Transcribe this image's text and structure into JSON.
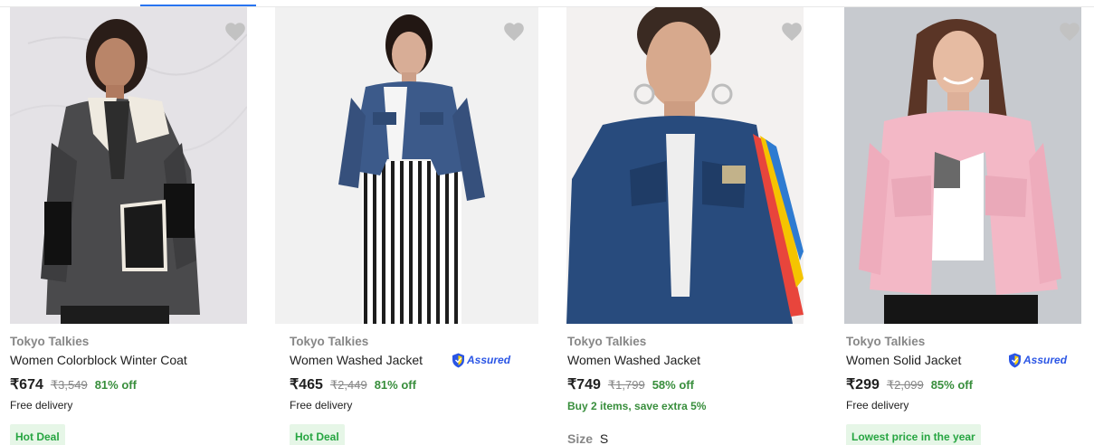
{
  "products": [
    {
      "brand": "Tokyo Talkies",
      "title": "Women Colorblock Winter Coat",
      "price": "₹674",
      "mrp": "₹3,549",
      "discount": "81% off",
      "delivery": "Free delivery",
      "badge": "Hot Deal",
      "image_alt": "Woman in grey colorblock winter coat with white lapels"
    },
    {
      "brand": "Tokyo Talkies",
      "title": "Women Washed Jacket",
      "price": "₹465",
      "mrp": "₹2,449",
      "discount": "81% off",
      "delivery": "Free delivery",
      "badge": "Hot Deal",
      "assured": "Assured",
      "image_alt": "Woman in cropped blue denim jacket over striped dress"
    },
    {
      "brand": "Tokyo Talkies",
      "title": "Women Washed Jacket",
      "price": "₹749",
      "mrp": "₹1,799",
      "discount": "58% off",
      "offer": "Buy 2 items, save extra 5%",
      "size_label": "Size",
      "size_value": "S",
      "image_alt": "Woman in dark blue denim jacket with rainbow sleeve stripe"
    },
    {
      "brand": "Tokyo Talkies",
      "title": "Women Solid Jacket",
      "price": "₹299",
      "mrp": "₹2,099",
      "discount": "85% off",
      "delivery": "Free delivery",
      "badge": "Lowest price in the year",
      "assured": "Assured",
      "image_alt": "Smiling woman in pink solid jacket"
    }
  ],
  "colors": {
    "accent": "#2874f0",
    "discount_green": "#388e3c",
    "badge_bg": "#e6f6e7",
    "badge_text": "#26a541",
    "muted": "#878787",
    "assured_blue": "#2a55e5",
    "heart": "#c2c2c2"
  },
  "icons": {
    "wishlist": "heart-icon",
    "assured": "assured-shield-icon"
  }
}
